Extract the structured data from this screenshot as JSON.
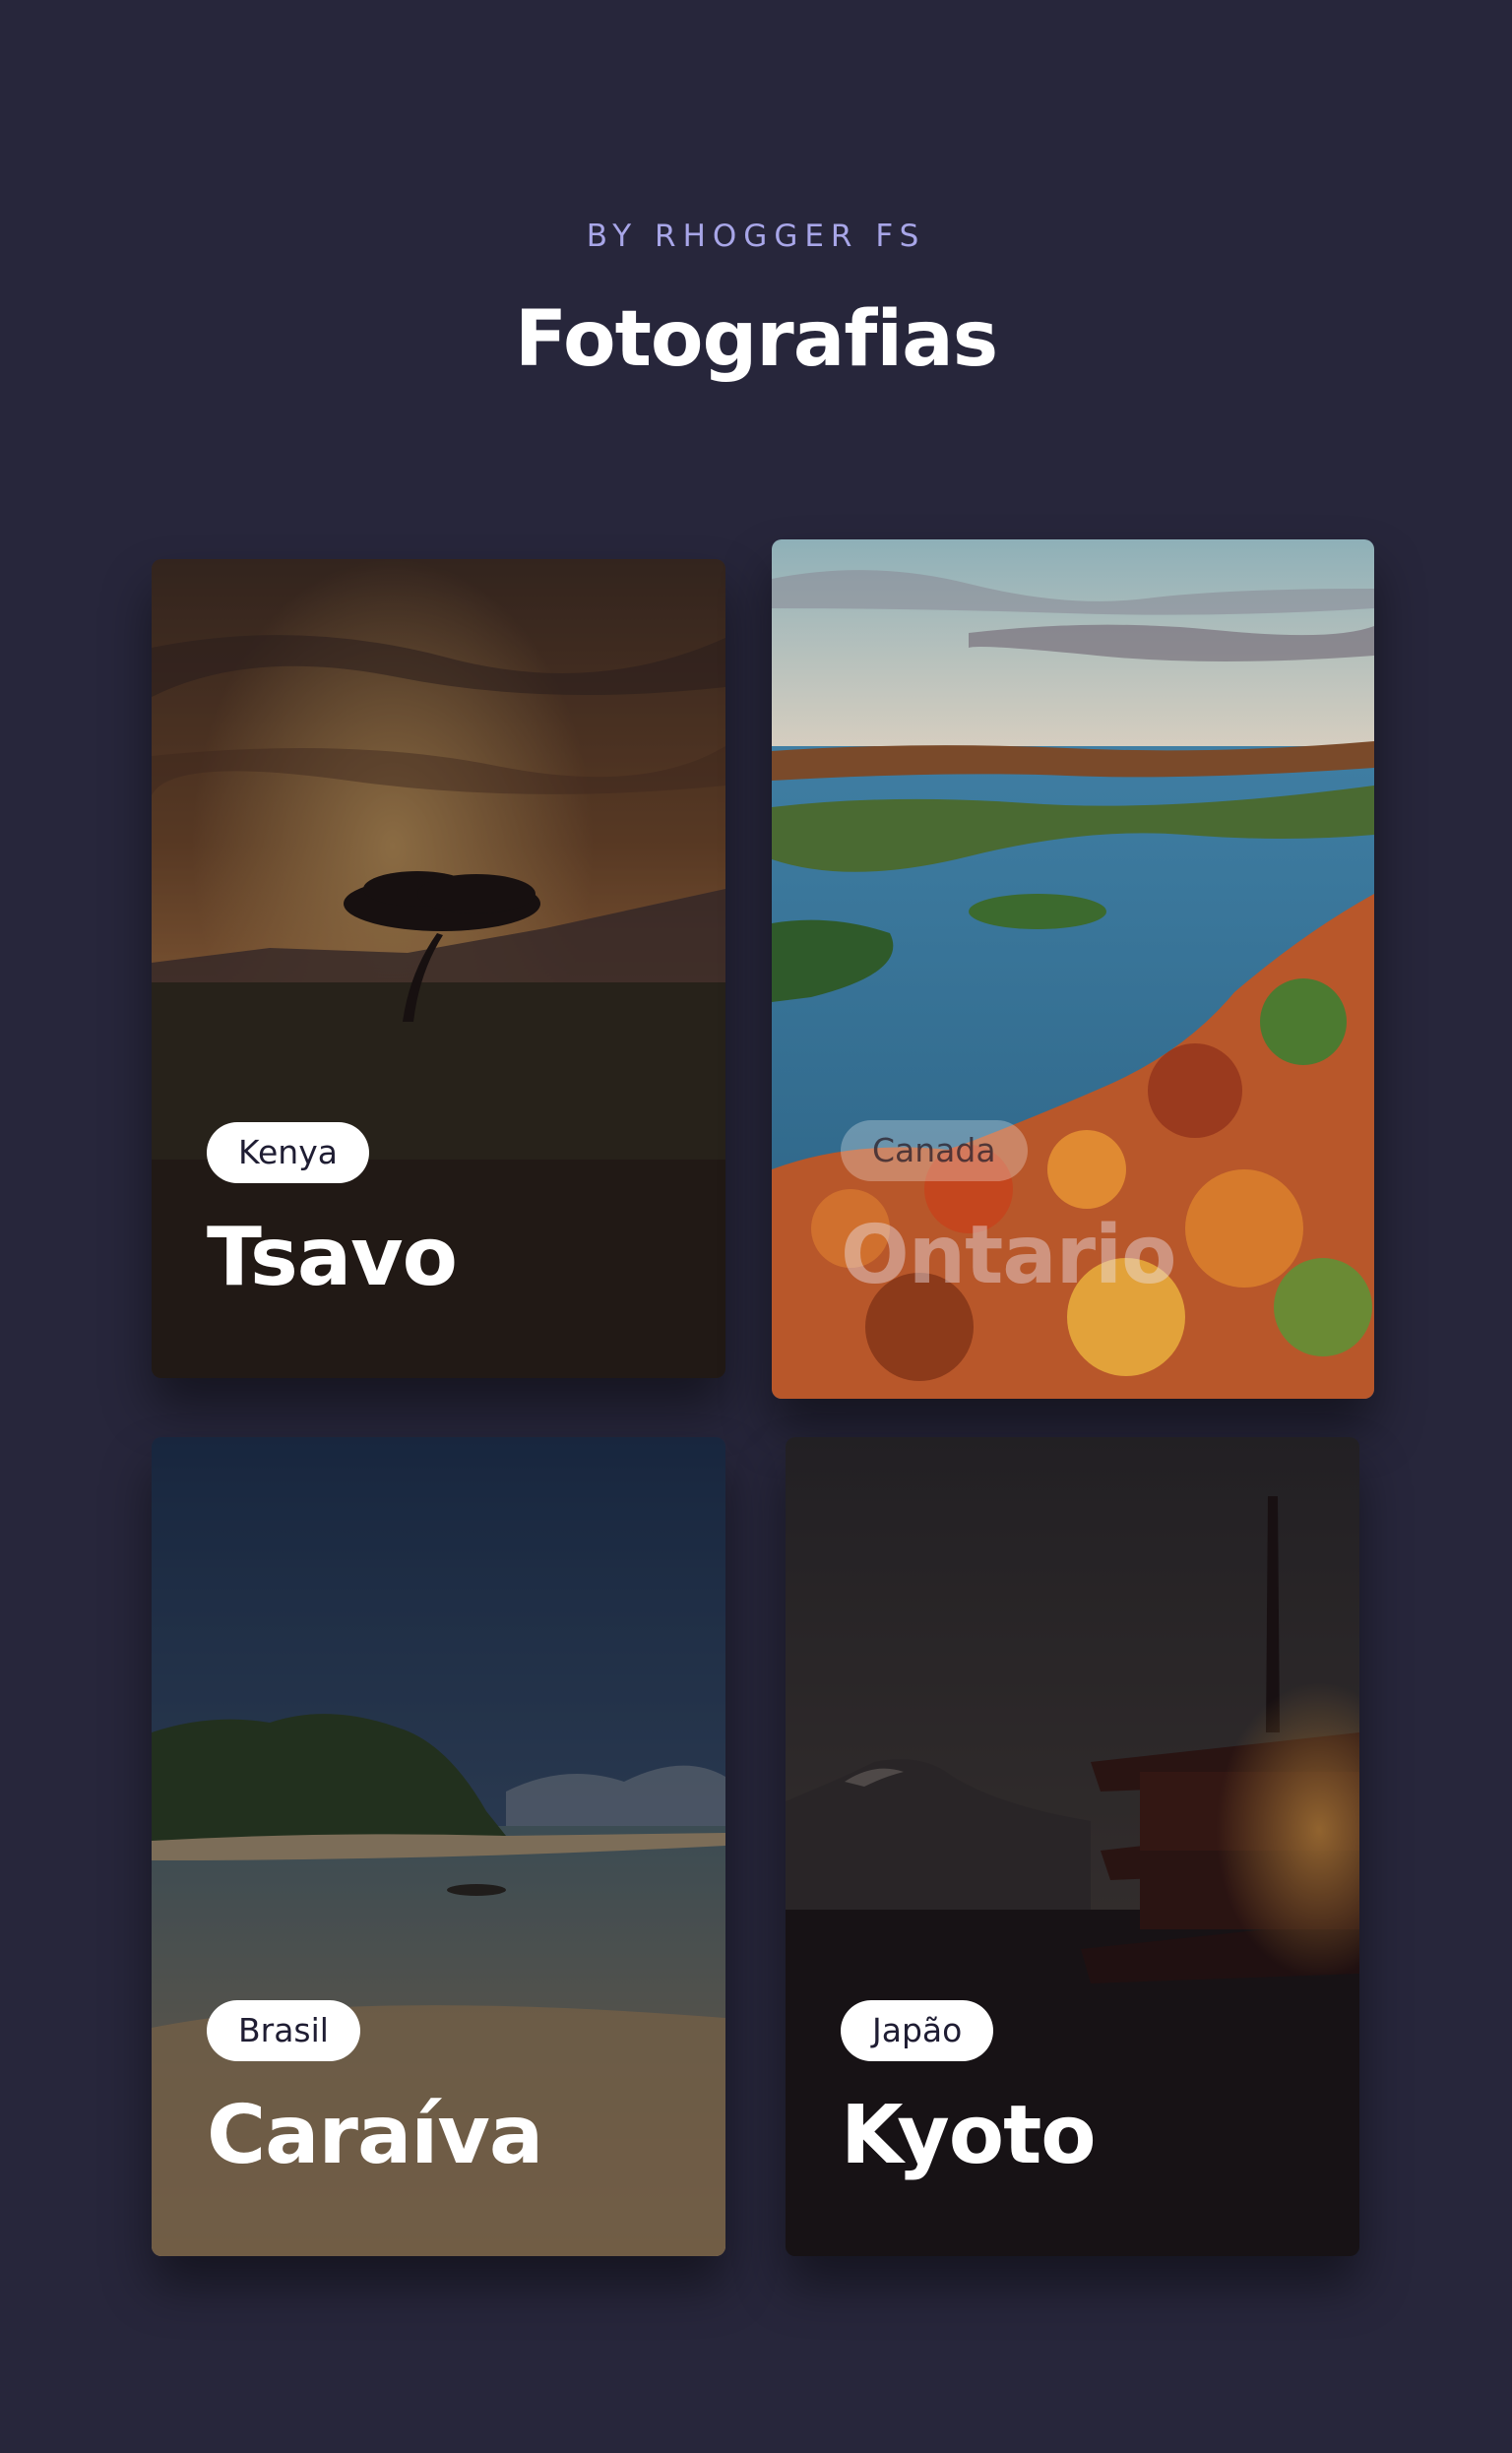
{
  "header": {
    "subtitle": "BY RHOGGER FS",
    "title": "Fotografias"
  },
  "cards": [
    {
      "country": "Kenya",
      "place": "Tsavo"
    },
    {
      "country": "Canada",
      "place": "Ontario"
    },
    {
      "country": "Brasil",
      "place": "Caraíva"
    },
    {
      "country": "Japão",
      "place": "Kyoto"
    }
  ],
  "colors": {
    "background": "#27263b",
    "subtitle": "#a8a6e8",
    "title": "#ffffff",
    "pill_bg": "#ffffff",
    "pill_text": "#1f1d33"
  }
}
